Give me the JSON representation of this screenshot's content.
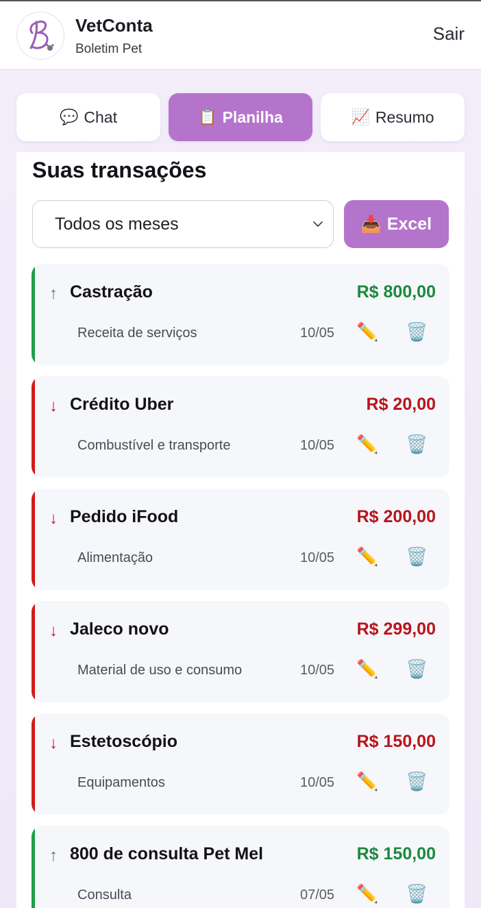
{
  "header": {
    "title": "VetConta",
    "subtitle": "Boletim Pet",
    "logout_label": "Sair",
    "logo_icon": "script-b-logo-icon"
  },
  "tabs": [
    {
      "icon": "💬",
      "label": "Chat",
      "active": false
    },
    {
      "icon": "📋",
      "label": "Planilha",
      "active": true
    },
    {
      "icon": "📈",
      "label": "Resumo",
      "active": false
    }
  ],
  "main": {
    "section_title": "Suas transações",
    "month_select": {
      "value": "Todos os meses"
    },
    "export_button": {
      "icon": "📥",
      "label": "Excel"
    }
  },
  "transactions": [
    {
      "type": "in",
      "arrow": "↑",
      "description": "Castração",
      "amount": "R$ 800,00",
      "category": "Receita de serviços",
      "date": "10/05",
      "edit_icon": "✏️",
      "delete_icon": "🗑️"
    },
    {
      "type": "out",
      "arrow": "↓",
      "description": "Crédito Uber",
      "amount": "R$ 20,00",
      "category": "Combustível e transporte",
      "date": "10/05",
      "edit_icon": "✏️",
      "delete_icon": "🗑️"
    },
    {
      "type": "out",
      "arrow": "↓",
      "description": "Pedido iFood",
      "amount": "R$ 200,00",
      "category": "Alimentação",
      "date": "10/05",
      "edit_icon": "✏️",
      "delete_icon": "🗑️"
    },
    {
      "type": "out",
      "arrow": "↓",
      "description": "Jaleco novo",
      "amount": "R$ 299,00",
      "category": "Material de uso e consumo",
      "date": "10/05",
      "edit_icon": "✏️",
      "delete_icon": "🗑️"
    },
    {
      "type": "out",
      "arrow": "↓",
      "description": "Estetoscópio",
      "amount": "R$ 150,00",
      "category": "Equipamentos",
      "date": "10/05",
      "edit_icon": "✏️",
      "delete_icon": "🗑️"
    },
    {
      "type": "in",
      "arrow": "↑",
      "description": "800 de consulta Pet Mel",
      "amount": "R$ 150,00",
      "category": "Consulta",
      "date": "07/05",
      "edit_icon": "✏️",
      "delete_icon": "🗑️"
    }
  ],
  "colors": {
    "accent": "#b474cc",
    "income": "#1a8a3e",
    "expense": "#b8141c"
  }
}
